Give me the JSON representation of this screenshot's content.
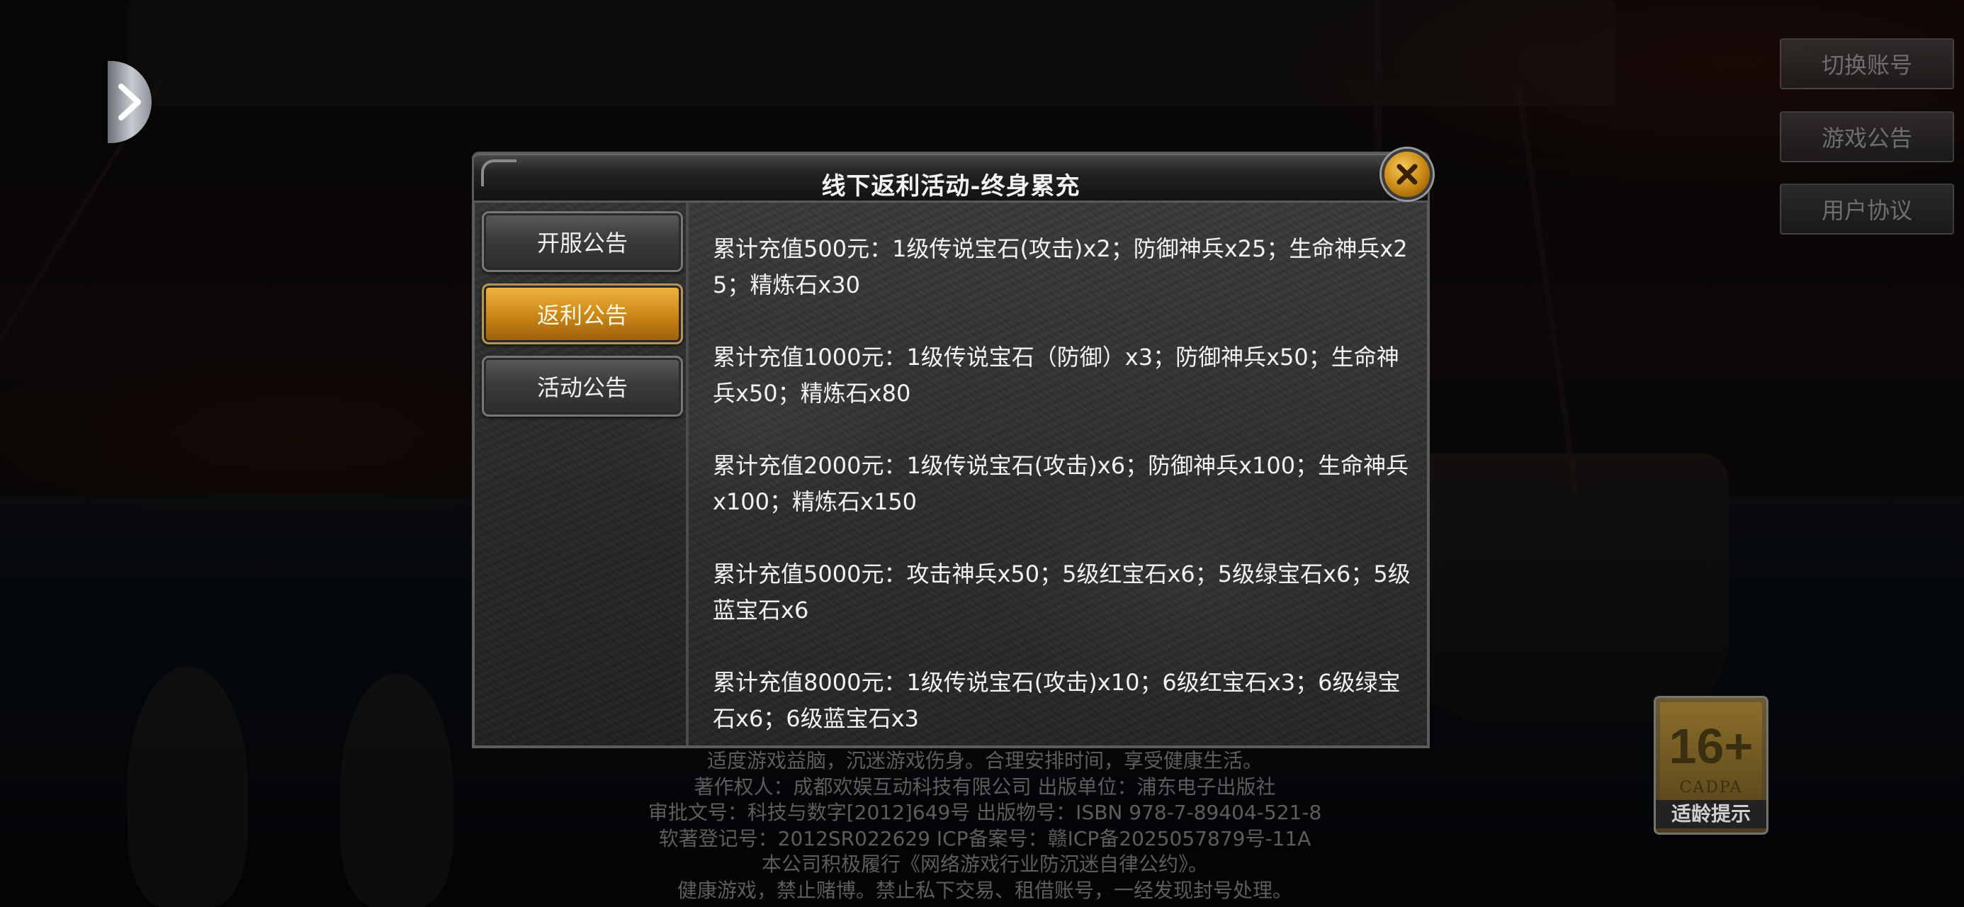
{
  "nav": {
    "expand_icon": "chevron-right-icon"
  },
  "side_menu": {
    "switch_account": "切换账号",
    "game_notice": "游戏公告",
    "user_agreement": "用户协议"
  },
  "modal": {
    "title": "线下返利活动-终身累充",
    "close_icon": "close-icon",
    "tabs": [
      {
        "label": "开服公告",
        "active": false
      },
      {
        "label": "返利公告",
        "active": true
      },
      {
        "label": "活动公告",
        "active": false
      }
    ],
    "entries": [
      "累计充值500元：1级传说宝石(攻击)x2；防御神兵x25；生命神兵x25；精炼石x30",
      "累计充值1000元：1级传说宝石（防御）x3；防御神兵x50；生命神兵x50；精炼石x80",
      "累计充值2000元：1级传说宝石(攻击)x6；防御神兵x100；生命神兵x100；精炼石x150",
      "累计充值5000元：攻击神兵x50；5级红宝石x6；5级绿宝石x6；5级蓝宝石x6",
      "累计充值8000元：1级传说宝石(攻击)x10；6级红宝石x3；6级绿宝石x6；6级蓝宝石x3"
    ]
  },
  "footer": {
    "lines": [
      "适度游戏益脑，沉迷游戏伤身。合理安排时间，享受健康生活。",
      "著作权人：成都欢娱互动科技有限公司  出版单位：浦东电子出版社",
      "审批文号：科技与数字[2012]649号        出版物号：ISBN 978-7-89404-521-8",
      "软著登记号：2012SR022629      ICP备案号：赣ICP备2025057879号-11A",
      "本公司积极履行《网络游戏行业防沉迷自律公约》。",
      "健康游戏，禁止赌博。禁止私下交易、租借账号，一经发现封号处理。"
    ]
  },
  "age_badge": {
    "rating": "16+",
    "org": "CADPA",
    "label": "适龄提示"
  },
  "colors": {
    "active_tab": "#d28d1c",
    "close_button": "#c78612",
    "text": "#f2f2f2"
  }
}
